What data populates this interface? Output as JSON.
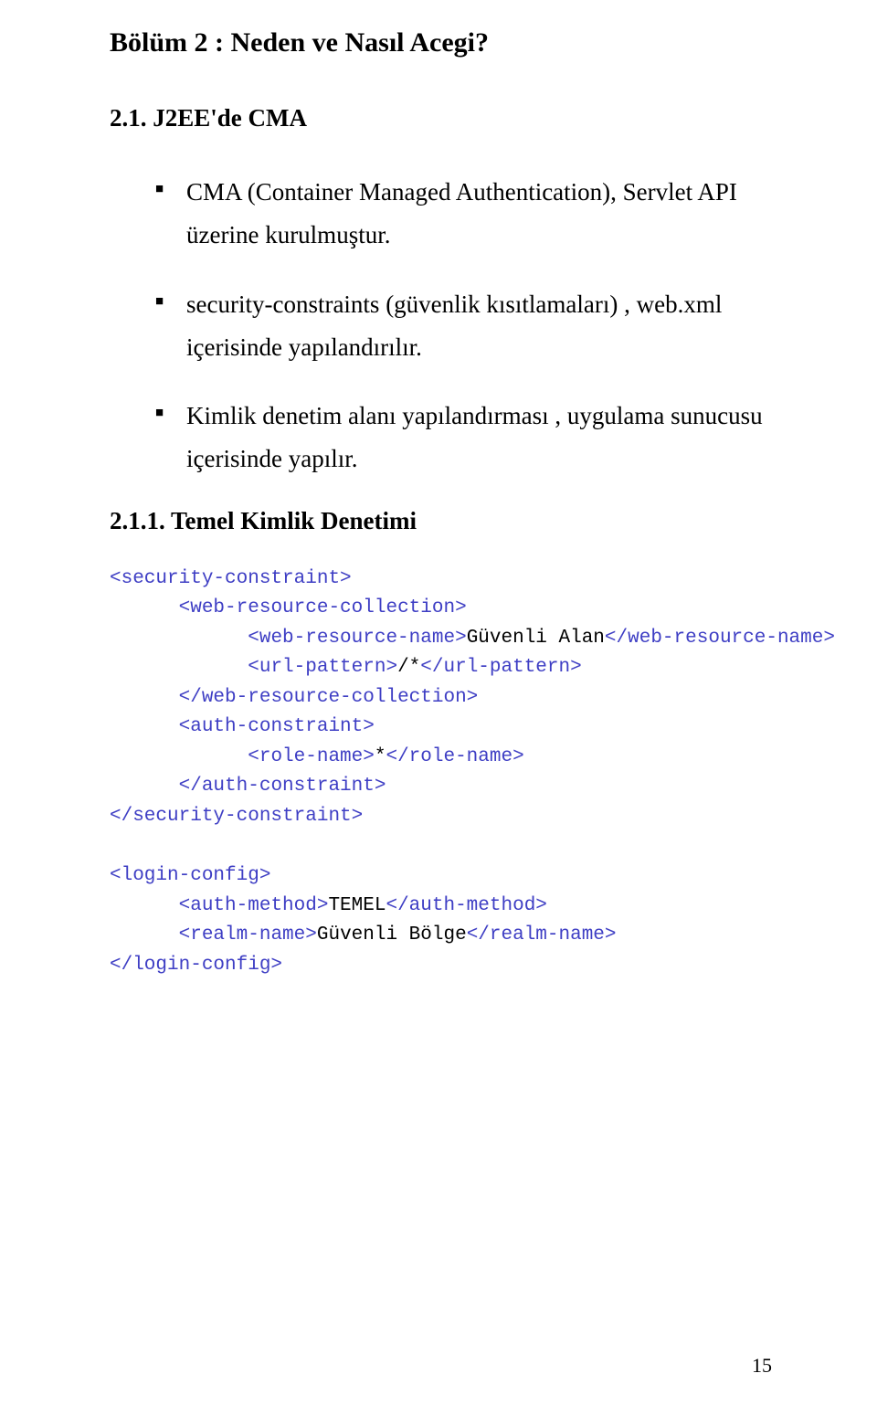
{
  "headings": {
    "chapter": "Bölüm 2 : Neden ve Nasıl Acegi?",
    "section": "2.1.  J2EE'de CMA",
    "subsection": "2.1.1. Temel Kimlik Denetimi"
  },
  "bullets": [
    "CMA (Container Managed Authentication), Servlet API üzerine kurulmuştur.",
    "security-constraints (güvenlik kısıtlamaları) , web.xml içerisinde yapılandırılır.",
    "Kimlik denetim alanı yapılandırması , uygulama sunucusu içerisinde yapılır."
  ],
  "code": {
    "t01": "<security-constraint>",
    "t02": "<web-resource-collection>",
    "t03a": "<web-resource-name>",
    "t03b": "Güvenli Alan",
    "t03c": "</web-resource-name>",
    "t04a": "<url-pattern>",
    "t04b": "/*",
    "t04c": "</url-pattern>",
    "t05": "</web-resource-collection>",
    "t06": "<auth-constraint>",
    "t07a": "<role-name>",
    "t07b": "*",
    "t07c": "</role-name>",
    "t08": "</auth-constraint>",
    "t09": "</security-constraint>",
    "t10": "<login-config>",
    "t11a": "<auth-method>",
    "t11b": "TEMEL",
    "t11c": "</auth-method>",
    "t12a": "<realm-name>",
    "t12b": "Güvenli Bölge",
    "t12c": "</realm-name>",
    "t13": "</login-config>"
  },
  "pagenum": "15"
}
